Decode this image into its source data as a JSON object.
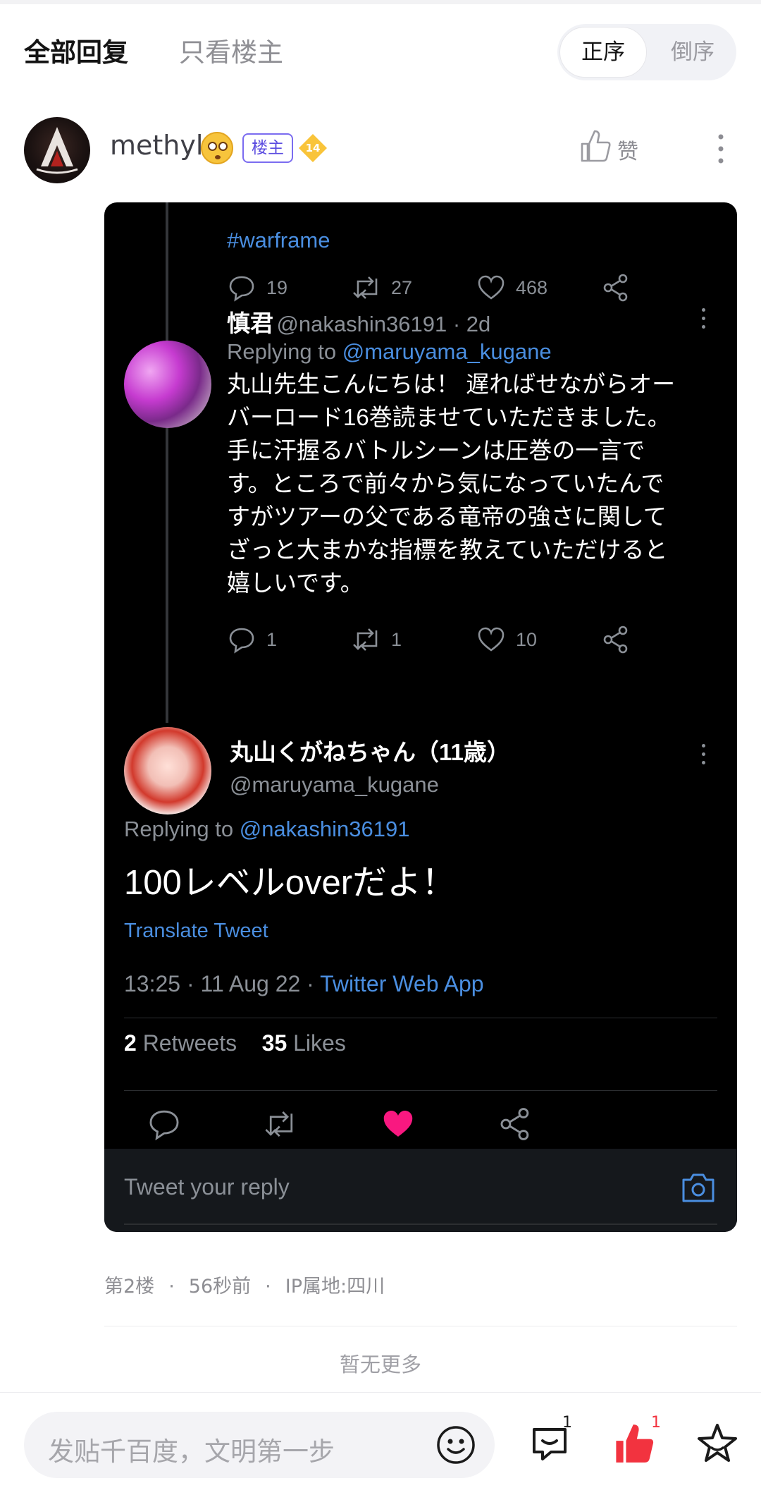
{
  "filter": {
    "all_replies": "全部回复",
    "op_only": "只看楼主",
    "sort_asc": "正序",
    "sort_desc": "倒序"
  },
  "post": {
    "username": "methyl",
    "op_badge": "楼主",
    "level": "14",
    "like_label": "赞",
    "floor": "第2楼",
    "time": "56秒前",
    "ip": "IP属地:四川"
  },
  "tweet_card": {
    "hashtag": "#warframe",
    "first_actions": {
      "replies": "19",
      "retweets": "27",
      "likes": "468"
    },
    "reply1": {
      "name": "慎君",
      "handle_time": "@nakashin36191 · 2d",
      "replying_prefix": "Replying to ",
      "replying_to": "@maruyama_kugane",
      "body_lines": [
        "丸山先生こんにちは！ 遅ればせながらオー",
        "バーロード16巻読ませていただきました。",
        "手に汗握るバトルシーンは圧巻の一言で",
        "す。ところで前々から気になっていたんで",
        "すがツアーの父である竜帝の強さに関して",
        "ざっと大まかな指標を教えていただけると",
        "嬉しいです。"
      ],
      "actions": {
        "replies": "1",
        "retweets": "1",
        "likes": "10"
      }
    },
    "main_tweet": {
      "name": "丸山くがねちゃん（11歳）",
      "handle": "@maruyama_kugane",
      "replying_prefix": "Replying to ",
      "replying_to": "@nakashin36191",
      "body": "100レベルoverだよ！",
      "translate": "Translate Tweet",
      "time": "13:25 · 11 Aug 22 · ",
      "source": "Twitter Web App",
      "retweet_count": "2",
      "retweet_label": " Retweets",
      "like_count": "35",
      "like_label": " Likes"
    },
    "reply_placeholder": "Tweet your reply"
  },
  "footer": {
    "no_more": "暂无更多"
  },
  "bottom_bar": {
    "input_placeholder": "发贴千百度，文明第一步",
    "comment_count": "1",
    "like_count": "1"
  },
  "colors": {
    "accent_purple": "#5a4be0",
    "tw_link": "#4a8ee0",
    "tw_like": "#f91880",
    "like_red": "#f2333f"
  },
  "icons": [
    "thumb-up-icon",
    "more-vertical-icon",
    "comment-icon",
    "retweet-icon",
    "heart-icon",
    "share-icon",
    "camera-icon",
    "smile-icon",
    "star-icon"
  ]
}
